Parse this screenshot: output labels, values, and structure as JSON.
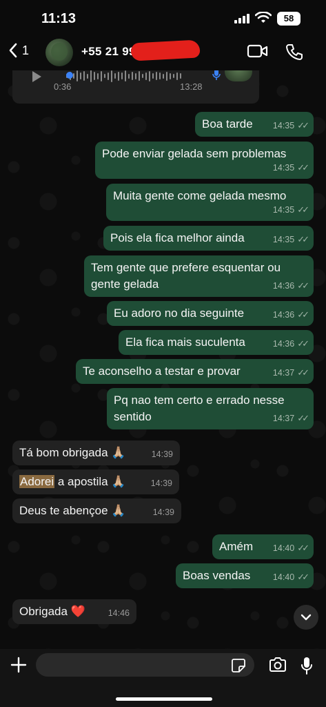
{
  "status": {
    "time": "11:13",
    "battery": "58"
  },
  "header": {
    "back_count": "1",
    "contact": "+55 21 99"
  },
  "voice_note": {
    "duration": "0:36",
    "time": "13:28"
  },
  "messages": [
    {
      "text": "Boa tarde",
      "time": "14:35",
      "dir": "out"
    },
    {
      "text": "Pode enviar gelada sem problemas",
      "time": "14:35",
      "dir": "out"
    },
    {
      "text": "Muita gente come gelada mesmo",
      "time": "14:35",
      "dir": "out"
    },
    {
      "text": "Pois ela fica melhor ainda",
      "time": "14:35",
      "dir": "out"
    },
    {
      "text_line1": "Tem gente que prefere esquentar ou",
      "text_line2": "gente gelada",
      "time": "14:36",
      "dir": "out"
    },
    {
      "text": "Eu adoro no dia seguinte",
      "time": "14:36",
      "dir": "out"
    },
    {
      "text": "Ela fica mais suculenta",
      "time": "14:36",
      "dir": "out"
    },
    {
      "text": "Te aconselho a testar e provar",
      "time": "14:37",
      "dir": "out"
    },
    {
      "text_line1": "Pq nao tem certo e errado nesse",
      "text_line2": "sentido",
      "time": "14:37",
      "dir": "out"
    },
    {
      "text": "Tá bom obrigada 🙏🏼",
      "time": "14:39",
      "dir": "in"
    },
    {
      "highlight": "Adorei",
      "text": " a apostila 🙏🏼",
      "time": "14:39",
      "dir": "in"
    },
    {
      "text": "Deus te abençoe 🙏🏼",
      "time": "14:39",
      "dir": "in"
    },
    {
      "text": "Amém",
      "time": "14:40",
      "dir": "out"
    },
    {
      "text": "Boas vendas",
      "time": "14:40",
      "dir": "out"
    },
    {
      "text": "Obrigada ❤️",
      "time": "14:46",
      "dir": "in"
    }
  ],
  "composer": {
    "placeholder": ""
  },
  "colors": {
    "outgoing_bubble": "#1f4d36",
    "incoming_bubble": "#222222",
    "background": "#0c0c0c"
  },
  "icons": [
    "back-chevron-icon",
    "video-call-icon",
    "phone-icon",
    "play-icon",
    "mic-icon",
    "double-check-icon",
    "chevron-down-icon",
    "plus-icon",
    "sticker-icon",
    "camera-icon"
  ]
}
